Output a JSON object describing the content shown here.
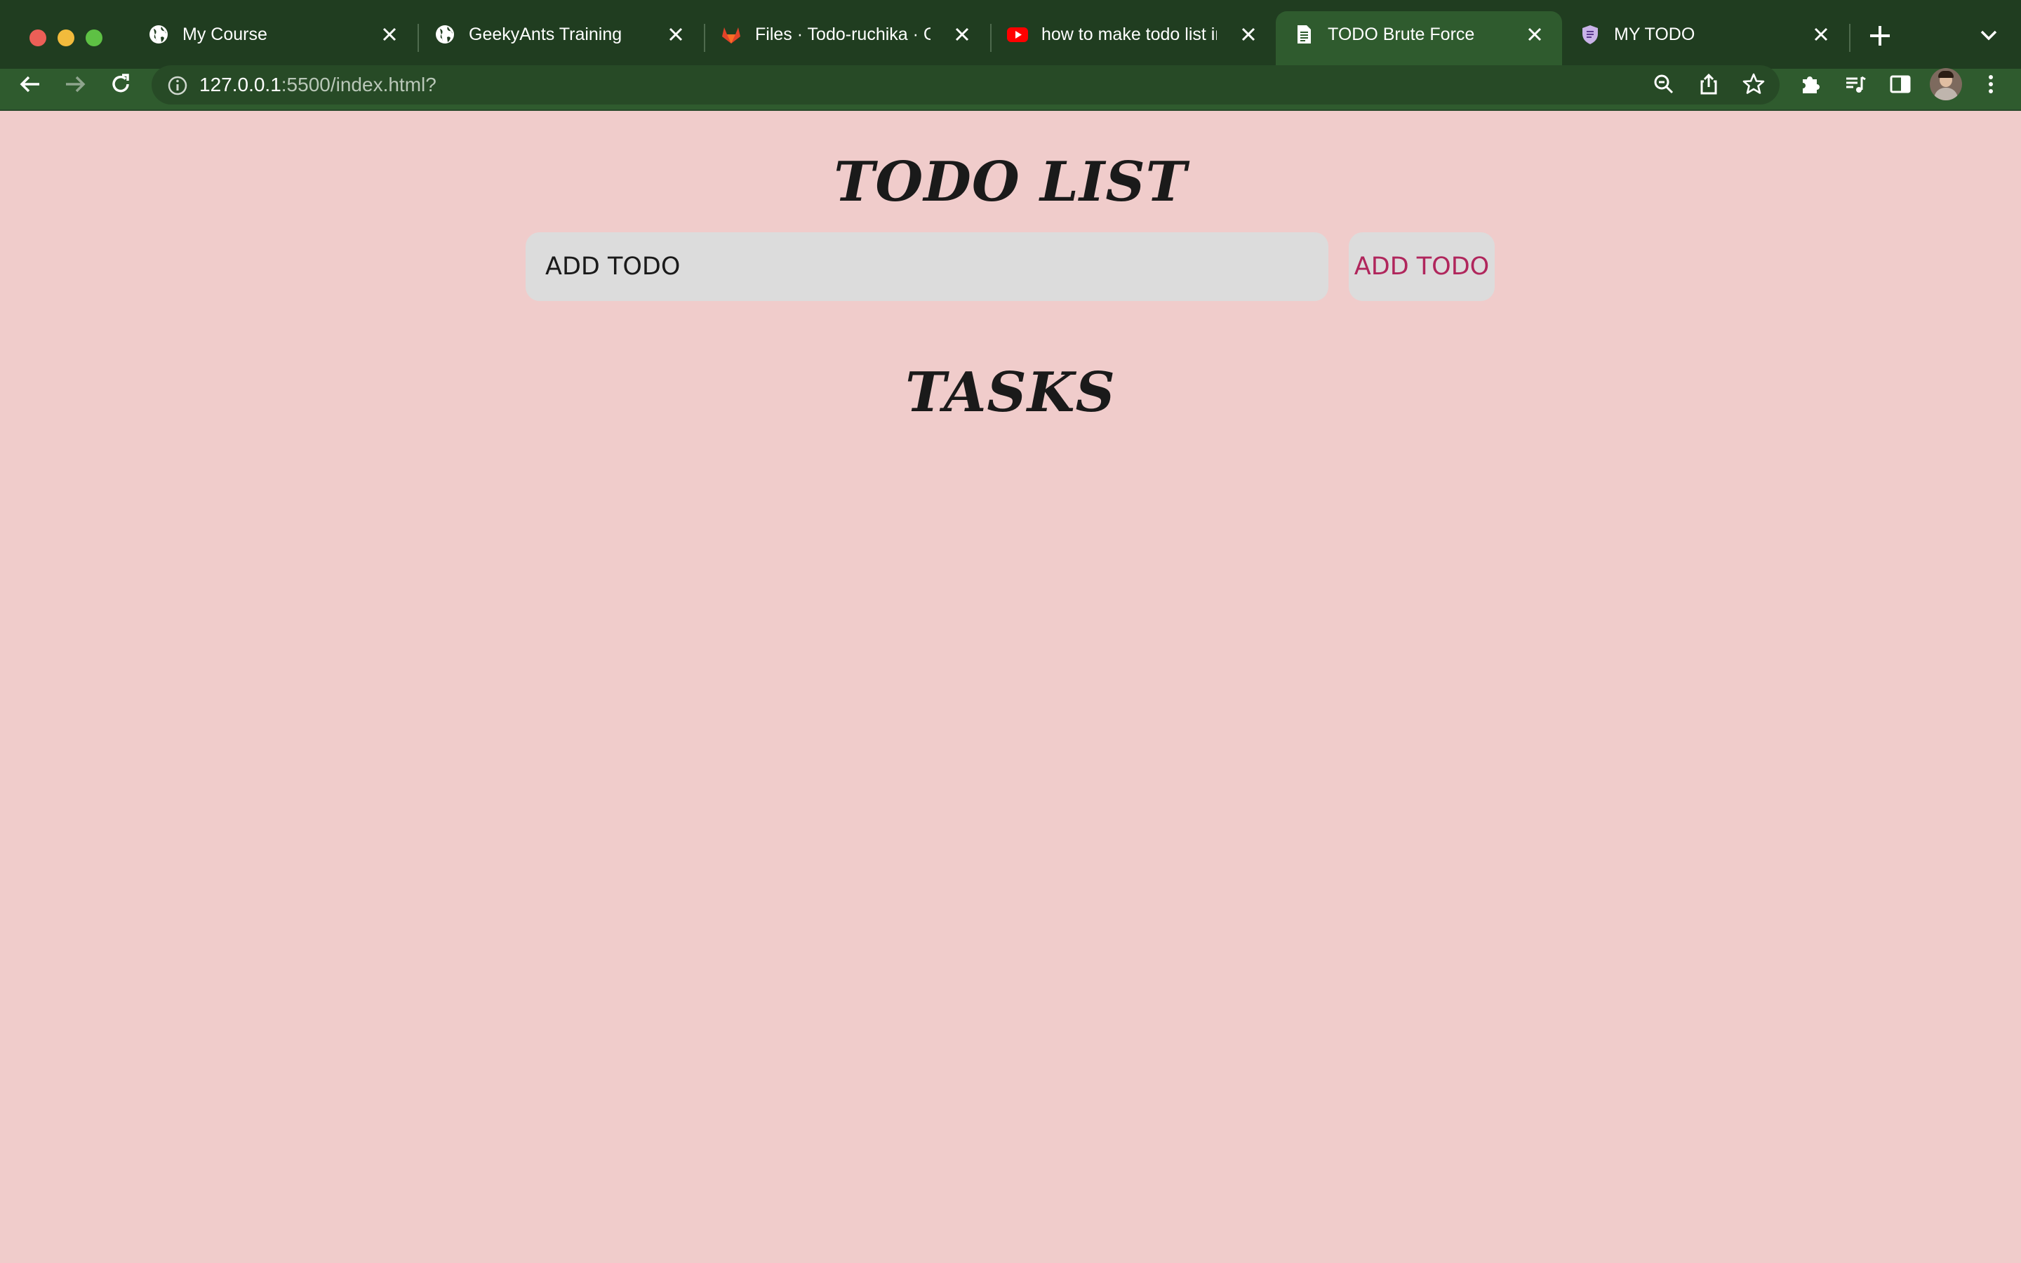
{
  "browser": {
    "tabs": [
      {
        "title": "My Course",
        "icon": "globe-icon",
        "active": false
      },
      {
        "title": "GeekyAnts Training",
        "icon": "globe-icon",
        "active": false
      },
      {
        "title": "Files · Todo-ruchika · Col",
        "icon": "gitlab-icon",
        "active": false
      },
      {
        "title": "how to make todo list in j",
        "icon": "youtube-icon",
        "active": false
      },
      {
        "title": "TODO Brute Force",
        "icon": "document-icon",
        "active": true
      },
      {
        "title": "MY TODO",
        "icon": "shield-icon",
        "active": false
      }
    ],
    "url_host": "127.0.0.1",
    "url_rest": ":5500/index.html?",
    "colors": {
      "tabstrip": "#203d20",
      "toolbar": "#2f5b2e"
    }
  },
  "page": {
    "title": "TODO LIST",
    "input_placeholder": "ADD TODO",
    "add_button_label": "ADD TODO",
    "tasks_heading": "TASKS",
    "tasks": [],
    "colors": {
      "background": "#f0cccb",
      "button_text": "#b0265c",
      "field": "#dcdcdc"
    }
  }
}
